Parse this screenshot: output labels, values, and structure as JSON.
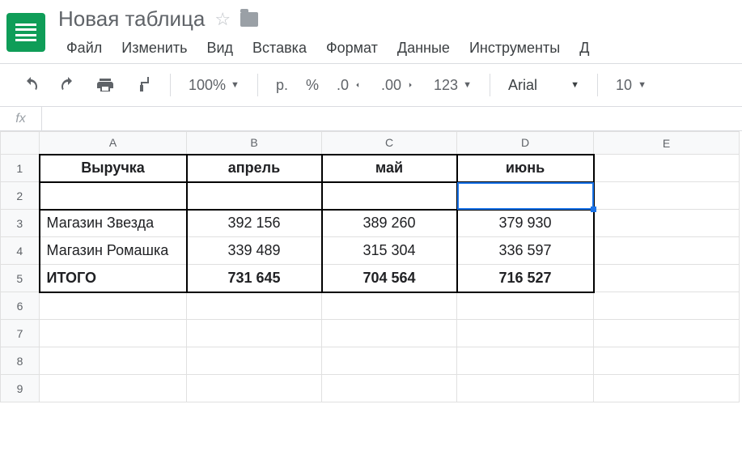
{
  "doc": {
    "title": "Новая таблица"
  },
  "menu": {
    "file": "Файл",
    "edit": "Изменить",
    "view": "Вид",
    "insert": "Вставка",
    "format": "Формат",
    "data": "Данные",
    "tools": "Инструменты",
    "addons_cut": "Д"
  },
  "toolbar": {
    "zoom": "100%",
    "currency": "р.",
    "percent": "%",
    "dec_dec": ".0",
    "inc_dec": ".00",
    "more_formats": "123",
    "font": "Arial",
    "size": "10"
  },
  "formula": {
    "fx_label": "fx",
    "value": ""
  },
  "columns": [
    "A",
    "B",
    "C",
    "D",
    "E"
  ],
  "rows": [
    "1",
    "2",
    "3",
    "4",
    "5",
    "6",
    "7",
    "8",
    "9"
  ],
  "selected_cell": "D2",
  "chart_data": {
    "type": "table",
    "title": "Выручка",
    "headers": [
      "Выручка",
      "апрель",
      "май",
      "июнь"
    ],
    "rows": [
      {
        "label": "Магазин Звезда",
        "values": [
          392156,
          389260,
          379930
        ]
      },
      {
        "label": "Магазин Ромашка",
        "values": [
          339489,
          315304,
          336597
        ]
      },
      {
        "label": "ИТОГО",
        "values": [
          731645,
          704564,
          716527
        ],
        "total": true
      }
    ],
    "display": {
      "r3": {
        "a": "Магазин Звезда",
        "b": "392 156",
        "c": "389 260",
        "d": "379 930"
      },
      "r4": {
        "a": "Магазин Ромашка",
        "b": "339 489",
        "c": "315 304",
        "d": "336 597"
      },
      "r5": {
        "a": "ИТОГО",
        "b": "731 645",
        "c": "704 564",
        "d": "716 527"
      }
    }
  }
}
